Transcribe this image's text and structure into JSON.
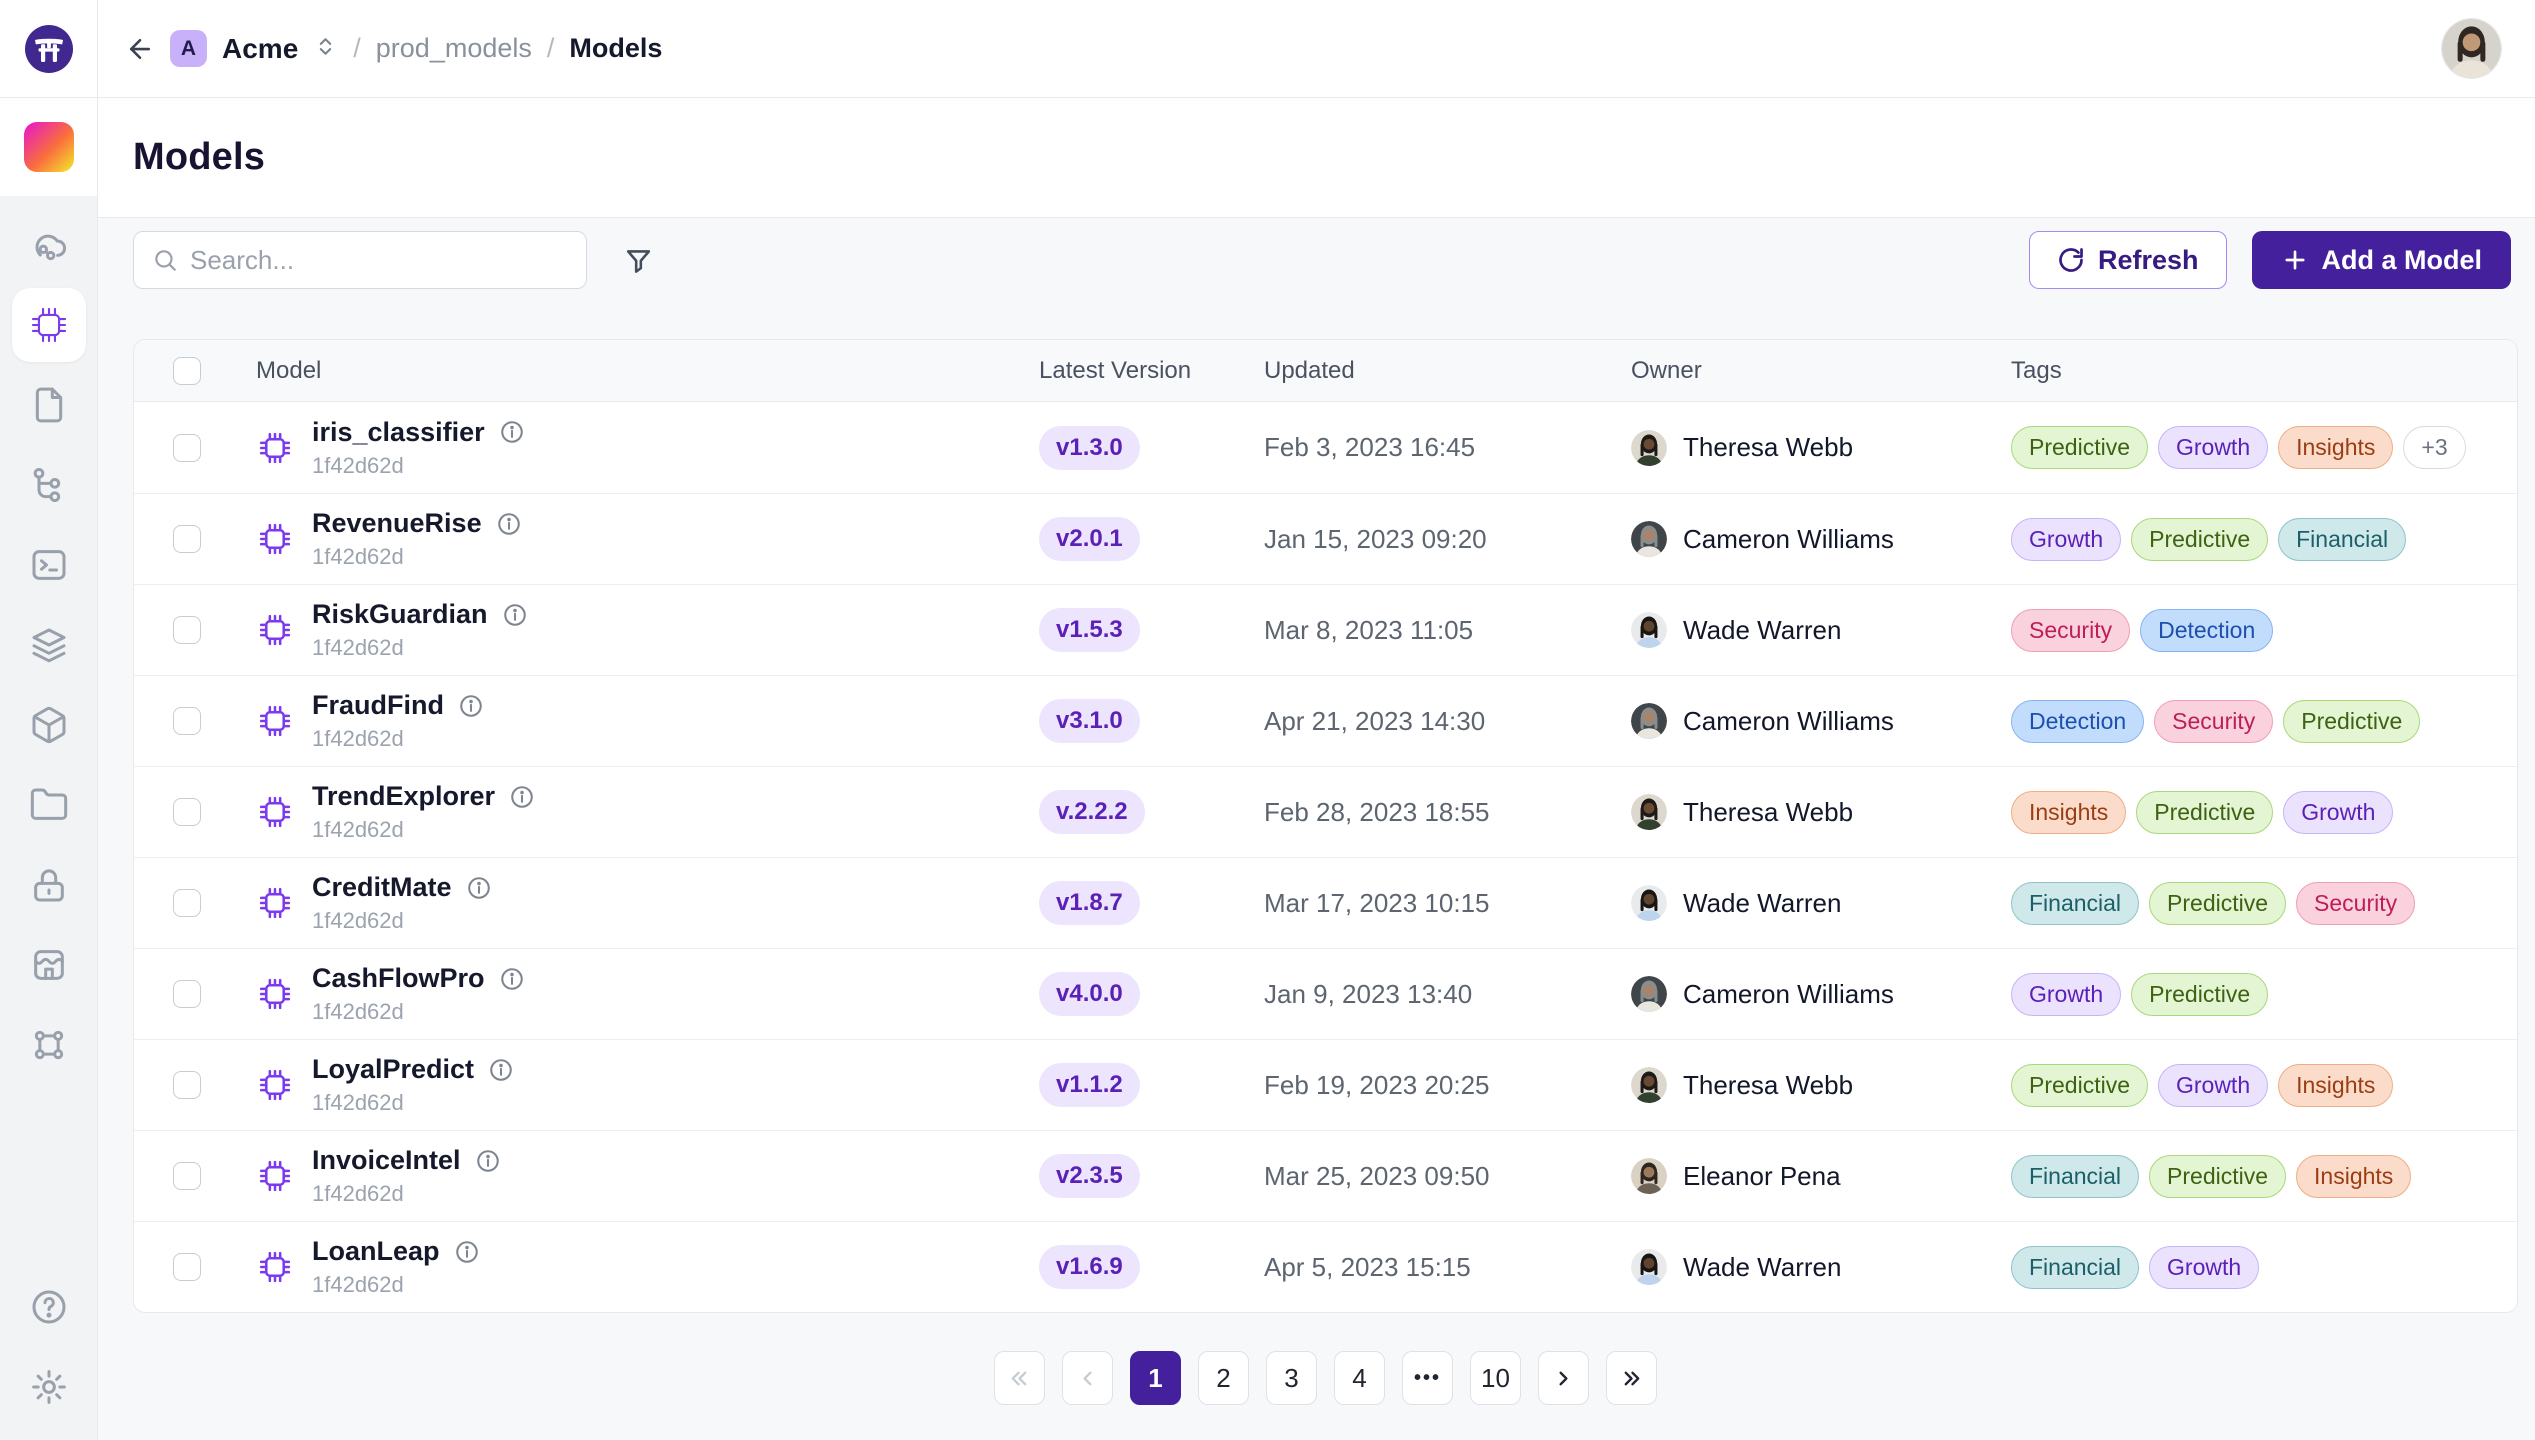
{
  "topbar": {
    "workspace_badge": "A",
    "workspace": "Acme",
    "separator": "/",
    "path": {
      "parent": "prod_models",
      "current": "Models"
    }
  },
  "page": {
    "title": "Models"
  },
  "toolbar": {
    "search_placeholder": "Search...",
    "refresh_label": "Refresh",
    "add_label": "Add a Model"
  },
  "sidebar": {
    "items": [
      "deployments",
      "models",
      "documents",
      "pipelines",
      "terminal",
      "environments",
      "packages",
      "files",
      "secrets",
      "marketplace",
      "frames"
    ],
    "active_item": "models",
    "footer_items": [
      "help",
      "settings"
    ]
  },
  "icons": [
    "torii-logo",
    "workspace-gradient",
    "arrow-left",
    "chevrons-up-down",
    "search",
    "filter-funnel",
    "refresh",
    "plus",
    "cloud-ml",
    "chip",
    "document",
    "branch-tree",
    "terminal",
    "layers",
    "cube",
    "folder",
    "lock",
    "storefront",
    "frame",
    "help-circle",
    "gear",
    "info-circle",
    "chevron-left",
    "chevron-right",
    "chevrons-left",
    "chevrons-right"
  ],
  "table": {
    "headers": [
      "Model",
      "Latest Version",
      "Updated",
      "Owner",
      "Tags"
    ],
    "rows": [
      {
        "name": "iris_classifier",
        "id": "1f42d62d",
        "version": "v1.3.0",
        "updated": "Feb 3, 2023 16:45",
        "owner": "Theresa Webb",
        "tags": [
          "Predictive",
          "Growth",
          "Insights"
        ],
        "more": "+3"
      },
      {
        "name": "RevenueRise",
        "id": "1f42d62d",
        "version": "v2.0.1",
        "updated": "Jan 15, 2023 09:20",
        "owner": "Cameron Williams",
        "tags": [
          "Growth",
          "Predictive",
          "Financial"
        ]
      },
      {
        "name": "RiskGuardian",
        "id": "1f42d62d",
        "version": "v1.5.3",
        "updated": "Mar 8, 2023 11:05",
        "owner": "Wade Warren",
        "tags": [
          "Security",
          "Detection"
        ]
      },
      {
        "name": "FraudFind",
        "id": "1f42d62d",
        "version": "v3.1.0",
        "updated": "Apr 21, 2023 14:30",
        "owner": "Cameron Williams",
        "tags": [
          "Detection",
          "Security",
          "Predictive"
        ]
      },
      {
        "name": "TrendExplorer",
        "id": "1f42d62d",
        "version": "v.2.2.2",
        "updated": "Feb 28, 2023 18:55",
        "owner": "Theresa Webb",
        "tags": [
          "Insights",
          "Predictive",
          "Growth"
        ]
      },
      {
        "name": "CreditMate",
        "id": "1f42d62d",
        "version": "v1.8.7",
        "updated": "Mar 17, 2023 10:15",
        "owner": "Wade Warren",
        "tags": [
          "Financial",
          "Predictive",
          "Security"
        ]
      },
      {
        "name": "CashFlowPro",
        "id": "1f42d62d",
        "version": "v4.0.0",
        "updated": "Jan 9, 2023 13:40",
        "owner": "Cameron Williams",
        "tags": [
          "Growth",
          "Predictive"
        ]
      },
      {
        "name": "LoyalPredict",
        "id": "1f42d62d",
        "version": "v1.1.2",
        "updated": "Feb 19, 2023 20:25",
        "owner": "Theresa Webb",
        "tags": [
          "Predictive",
          "Growth",
          "Insights"
        ]
      },
      {
        "name": "InvoiceIntel",
        "id": "1f42d62d",
        "version": "v2.3.5",
        "updated": "Mar 25, 2023 09:50",
        "owner": "Eleanor Pena",
        "tags": [
          "Financial",
          "Predictive",
          "Insights"
        ]
      },
      {
        "name": "LoanLeap",
        "id": "1f42d62d",
        "version": "v1.6.9",
        "updated": "Apr 5, 2023 15:15",
        "owner": "Wade Warren",
        "tags": [
          "Financial",
          "Growth"
        ]
      }
    ]
  },
  "tag_colors": {
    "Predictive": {
      "bg": "#e3f5d3",
      "border": "#a8d87c",
      "text": "#3f6212"
    },
    "Growth": {
      "bg": "#ebe3fd",
      "border": "#c7b4f8",
      "text": "#5b21b6"
    },
    "Insights": {
      "bg": "#fbdcca",
      "border": "#eeae85",
      "text": "#9a3d12"
    },
    "Financial": {
      "bg": "#cfe8ea",
      "border": "#90c3c9",
      "text": "#1b5f68"
    },
    "Security": {
      "bg": "#fad2dd",
      "border": "#f09eb4",
      "text": "#bf1d57"
    },
    "Detection": {
      "bg": "#c2ddfc",
      "border": "#85b4f3",
      "text": "#1d4fae"
    }
  },
  "avatar_colors": {
    "Theresa Webb": {
      "bg": "#ddd8cd",
      "skin": "#6b4a34",
      "body": "#31402f",
      "hair": "#1d1a17"
    },
    "Cameron Williams": {
      "bg": "#3f4548",
      "skin": "#a9846a",
      "body": "#e9e6df",
      "hair": "#8a8d8e"
    },
    "Wade Warren": {
      "bg": "#e8eaec",
      "skin": "#5f4430",
      "body": "#bdd4ec",
      "hair": "#181512"
    },
    "Eleanor Pena": {
      "bg": "#d9d2c4",
      "skin": "#9b7a5c",
      "body": "#6e6257",
      "hair": "#2e2620"
    },
    "current_user": {
      "bg": "#d6d2cc",
      "skin": "#c09a76",
      "body": "#eae4d8",
      "hair": "#2f2721"
    },
    "default": {
      "bg": "#e4e7eb",
      "skin": "#9aa3ad",
      "body": "#c3c9d1"
    }
  },
  "colors": {
    "primary": "#44209c",
    "accent_purple": "#7c3aed",
    "refresh_border": "#a688f2",
    "version_badge_bg": "#ece5fd",
    "version_badge_text": "#5b21b6",
    "logo_bg": "#41288e",
    "workspace_badge_bg": "#c9b1fa"
  },
  "pagination": {
    "items": [
      {
        "name": "first-page",
        "icon": "dleft",
        "enabled": false
      },
      {
        "name": "previous-page",
        "icon": "left",
        "enabled": false
      },
      {
        "name": "page-1",
        "label": "1",
        "active": true
      },
      {
        "name": "page-2",
        "label": "2"
      },
      {
        "name": "page-3",
        "label": "3"
      },
      {
        "name": "page-4",
        "label": "4"
      },
      {
        "name": "ellipsis",
        "label": "•••",
        "dots": true
      },
      {
        "name": "page-10",
        "label": "10"
      },
      {
        "name": "next-page",
        "icon": "right"
      },
      {
        "name": "last-page",
        "icon": "dright"
      }
    ]
  }
}
